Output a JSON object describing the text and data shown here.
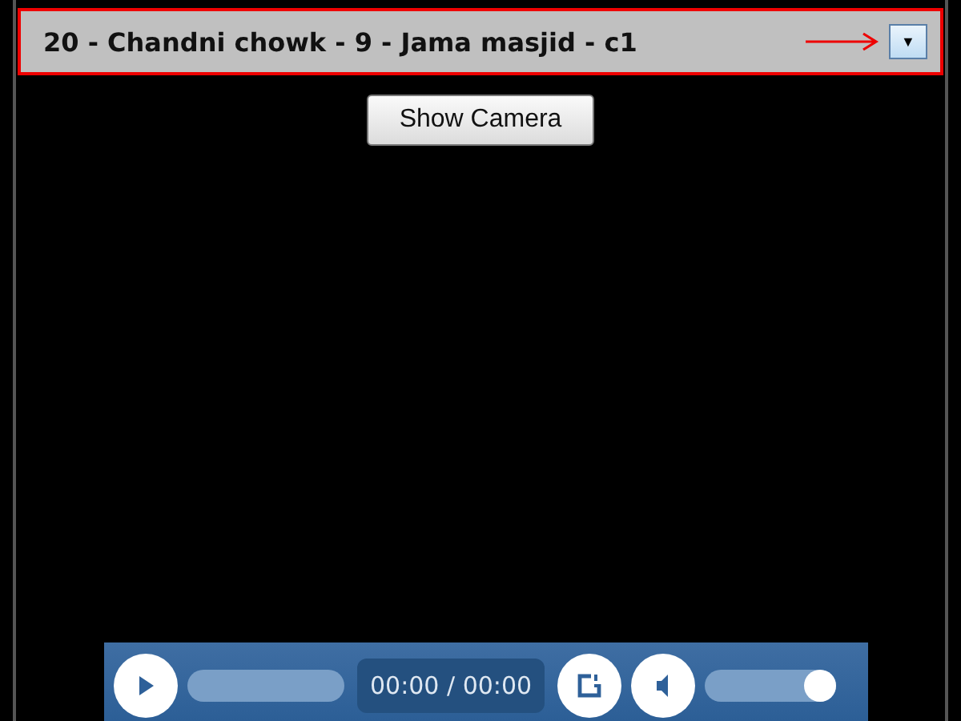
{
  "header": {
    "title": "20 - Chandni chowk - 9 - Jama masjid - c1",
    "dropdown_icon": "▼"
  },
  "show_camera_button": "Show Camera",
  "player": {
    "time": "00:00 / 00:00",
    "seek": {
      "level": 0
    },
    "volume": {
      "level": 1
    }
  }
}
